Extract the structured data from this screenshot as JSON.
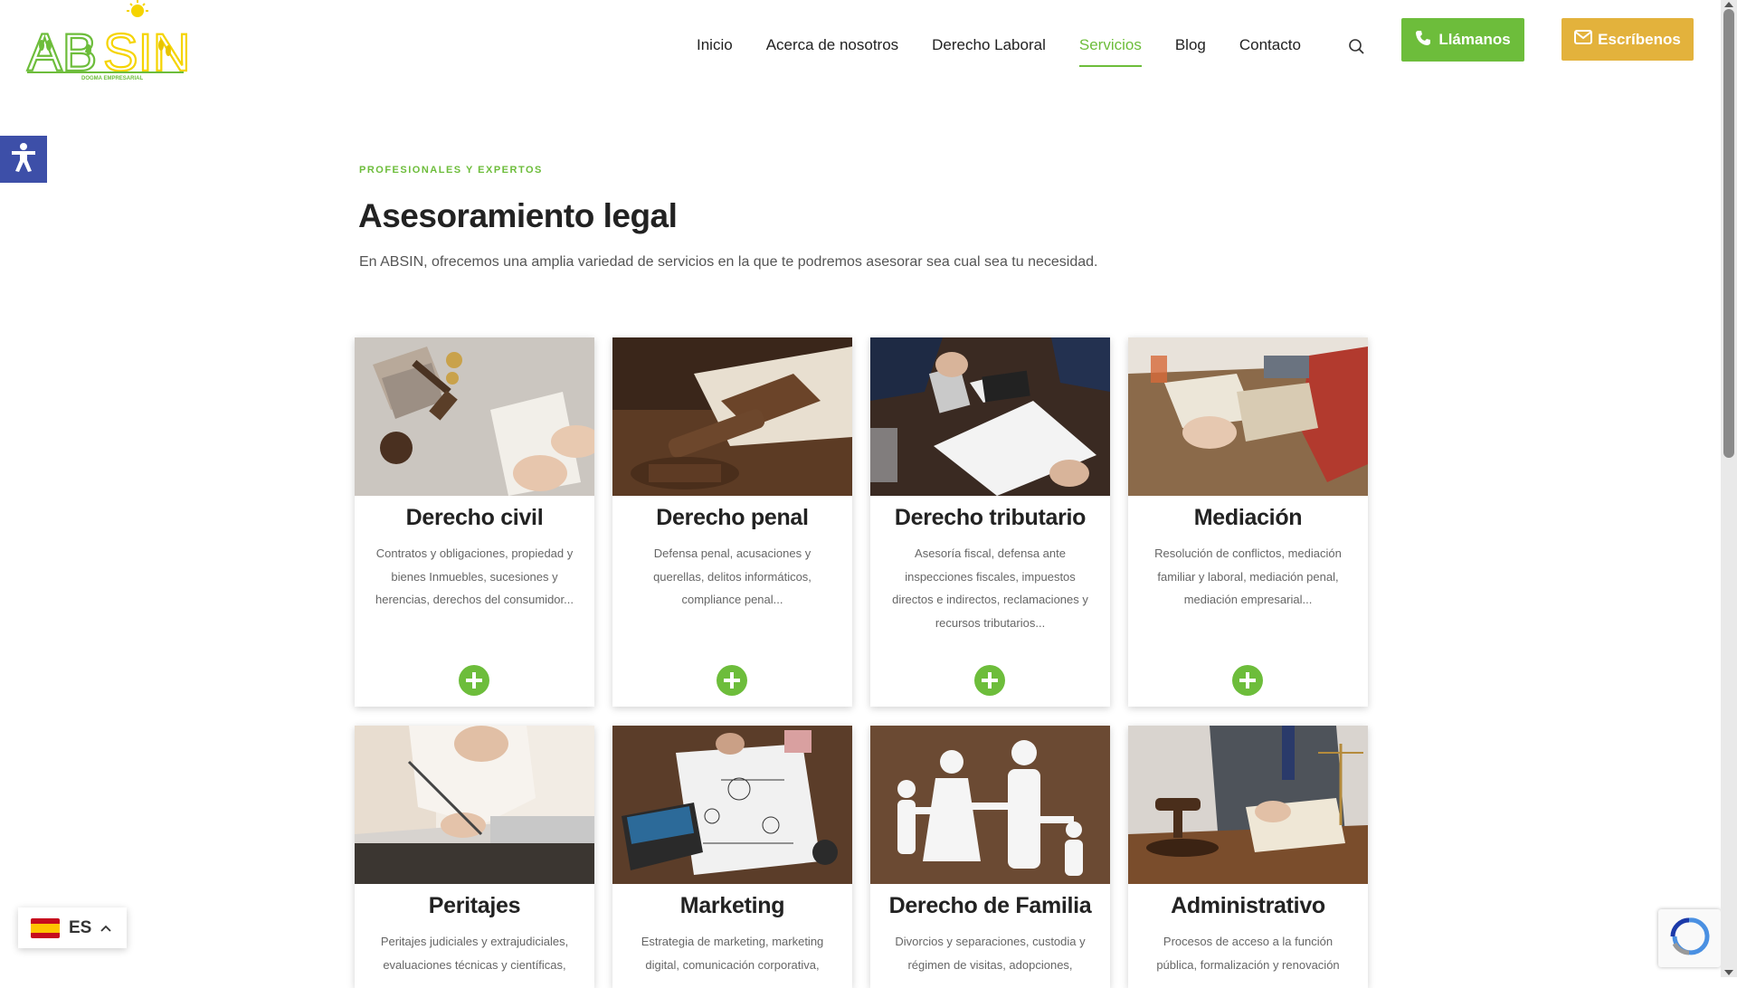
{
  "header": {
    "logo_text": "ABSIN",
    "logo_tagline": "DOGMA EMPRESARIAL",
    "nav": [
      {
        "label": "Inicio",
        "active": false
      },
      {
        "label": "Acerca de nosotros",
        "active": false
      },
      {
        "label": "Derecho Laboral",
        "active": false
      },
      {
        "label": "Servicios",
        "active": true
      },
      {
        "label": "Blog",
        "active": false
      },
      {
        "label": "Contacto",
        "active": false
      }
    ],
    "call_label": "Llámanos",
    "write_label": "Escríbenos"
  },
  "intro": {
    "eyebrow": "PROFESIONALES Y EXPERTOS",
    "title": "Asesoramiento legal",
    "subtitle": "En ABSIN, ofrecemos una amplia variedad de servicios en la que te podremos asesorar sea cual sea tu necesidad."
  },
  "cards": [
    {
      "title": "Derecho civil",
      "text": "Contratos y obligaciones, propiedad y bienes Inmuebles, sucesiones y herencias, derechos del consumidor..."
    },
    {
      "title": "Derecho penal",
      "text": "Defensa penal, acusaciones y querellas, delitos informáticos, compliance penal..."
    },
    {
      "title": "Derecho tributario",
      "text": "Asesoría fiscal, defensa ante inspecciones fiscales, impuestos directos e indirectos, reclamaciones y recursos tributarios..."
    },
    {
      "title": "Mediación",
      "text": "Resolución de conflictos, mediación familiar y laboral, mediación penal, mediación empresarial..."
    },
    {
      "title": "Peritajes",
      "text": "Peritajes judiciales y extrajudiciales, evaluaciones técnicas y científicas,"
    },
    {
      "title": "Marketing",
      "text": "Estrategia de marketing, marketing digital, comunicación corporativa,"
    },
    {
      "title": "Derecho de Familia",
      "text": "Divorcios y separaciones, custodia y régimen de visitas, adopciones,"
    },
    {
      "title": "Administrativo",
      "text": "Procesos de acceso a la función pública, formalización y renovación"
    }
  ],
  "language": {
    "code": "ES"
  },
  "colors": {
    "green": "#6dbd3b",
    "gold": "#e3b23c",
    "accessibility": "#3d4fa8"
  }
}
